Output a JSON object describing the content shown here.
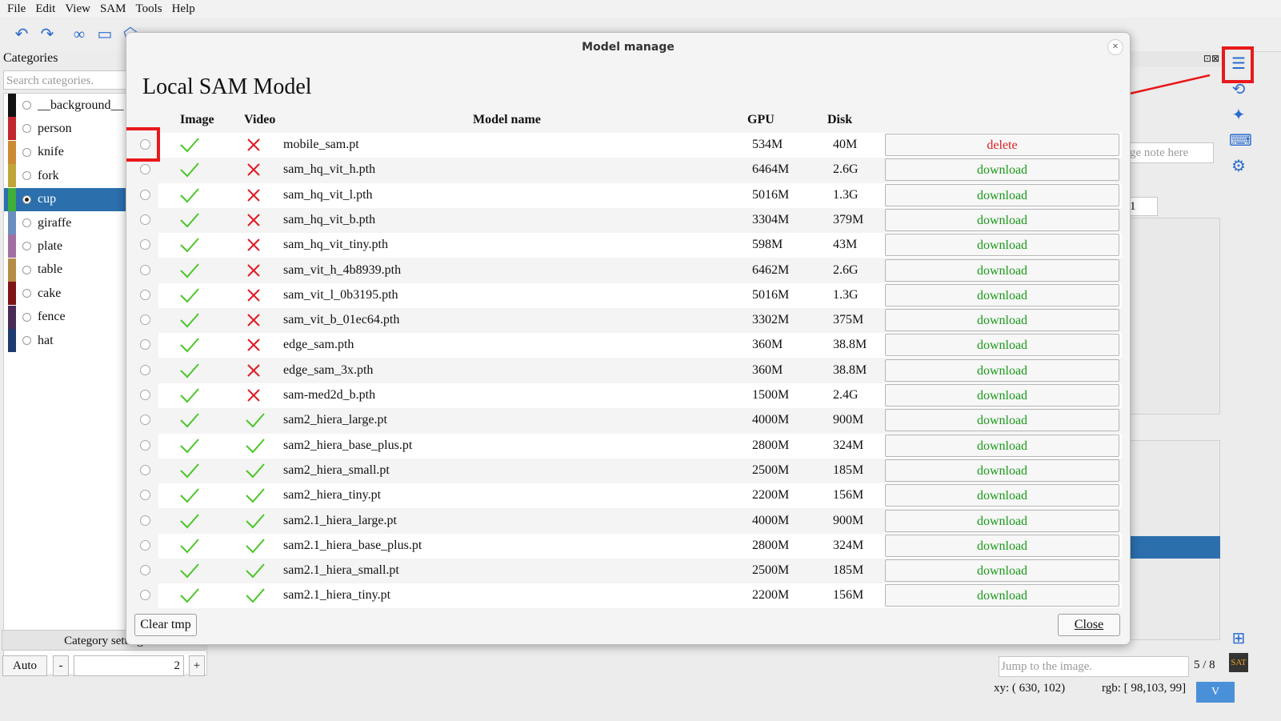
{
  "menu": [
    "File",
    "Edit",
    "View",
    "SAM",
    "Tools",
    "Help"
  ],
  "left_panel": {
    "title": "Categories",
    "search_placeholder": "Search categories.",
    "categories": [
      {
        "label": "__background__",
        "color": "#111111"
      },
      {
        "label": "person",
        "color": "#c0282d"
      },
      {
        "label": "knife",
        "color": "#cc8a32"
      },
      {
        "label": "fork",
        "color": "#c0a63a"
      },
      {
        "label": "cup",
        "color": "#3fae3a",
        "selected": true
      },
      {
        "label": "giraffe",
        "color": "#6a8fbf"
      },
      {
        "label": "plate",
        "color": "#a26fa3"
      },
      {
        "label": "table",
        "color": "#b58c45"
      },
      {
        "label": "cake",
        "color": "#7d1515"
      },
      {
        "label": "fence",
        "color": "#4a2b56"
      },
      {
        "label": "hat",
        "color": "#1f3a6e"
      }
    ],
    "category_setting_label": "Category setting",
    "auto_label": "Auto",
    "minus_label": "-",
    "plus_label": "+",
    "spin_value": "2"
  },
  "right_panel": {
    "note_placeholder": "ge note here",
    "spin_value": "1",
    "jump_placeholder": "Jump to the image.",
    "page_counter": "5 / 8"
  },
  "status": {
    "xy": "xy: ( 630, 102)",
    "rgb": "rgb: [ 98,103, 99]",
    "version_label": "V"
  },
  "dialog": {
    "title": "Model manage",
    "close_x": "×",
    "heading": "Local SAM Model",
    "columns": {
      "image": "Image",
      "video": "Video",
      "name": "Model name",
      "gpu": "GPU",
      "disk": "Disk"
    },
    "models": [
      {
        "name": "mobile_sam.pt",
        "video": false,
        "gpu": "534M",
        "disk": "40M",
        "action": "delete"
      },
      {
        "name": "sam_hq_vit_h.pth",
        "video": false,
        "gpu": "6464M",
        "disk": "2.6G",
        "action": "download"
      },
      {
        "name": "sam_hq_vit_l.pth",
        "video": false,
        "gpu": "5016M",
        "disk": "1.3G",
        "action": "download"
      },
      {
        "name": "sam_hq_vit_b.pth",
        "video": false,
        "gpu": "3304M",
        "disk": "379M",
        "action": "download"
      },
      {
        "name": "sam_hq_vit_tiny.pth",
        "video": false,
        "gpu": "598M",
        "disk": "43M",
        "action": "download"
      },
      {
        "name": "sam_vit_h_4b8939.pth",
        "video": false,
        "gpu": "6462M",
        "disk": "2.6G",
        "action": "download"
      },
      {
        "name": "sam_vit_l_0b3195.pth",
        "video": false,
        "gpu": "5016M",
        "disk": "1.3G",
        "action": "download"
      },
      {
        "name": "sam_vit_b_01ec64.pth",
        "video": false,
        "gpu": "3302M",
        "disk": "375M",
        "action": "download"
      },
      {
        "name": "edge_sam.pth",
        "video": false,
        "gpu": "360M",
        "disk": "38.8M",
        "action": "download"
      },
      {
        "name": "edge_sam_3x.pth",
        "video": false,
        "gpu": "360M",
        "disk": "38.8M",
        "action": "download"
      },
      {
        "name": "sam-med2d_b.pth",
        "video": false,
        "gpu": "1500M",
        "disk": "2.4G",
        "action": "download"
      },
      {
        "name": "sam2_hiera_large.pt",
        "video": true,
        "gpu": "4000M",
        "disk": "900M",
        "action": "download"
      },
      {
        "name": "sam2_hiera_base_plus.pt",
        "video": true,
        "gpu": "2800M",
        "disk": "324M",
        "action": "download"
      },
      {
        "name": "sam2_hiera_small.pt",
        "video": true,
        "gpu": "2500M",
        "disk": "185M",
        "action": "download"
      },
      {
        "name": "sam2_hiera_tiny.pt",
        "video": true,
        "gpu": "2200M",
        "disk": "156M",
        "action": "download"
      },
      {
        "name": "sam2.1_hiera_large.pt",
        "video": true,
        "gpu": "4000M",
        "disk": "900M",
        "action": "download"
      },
      {
        "name": "sam2.1_hiera_base_plus.pt",
        "video": true,
        "gpu": "2800M",
        "disk": "324M",
        "action": "download"
      },
      {
        "name": "sam2.1_hiera_small.pt",
        "video": true,
        "gpu": "2500M",
        "disk": "185M",
        "action": "download"
      },
      {
        "name": "sam2.1_hiera_tiny.pt",
        "video": true,
        "gpu": "2200M",
        "disk": "156M",
        "action": "download"
      }
    ],
    "clear_tmp_label": "Clear tmp",
    "close_label": "Close"
  },
  "colors": {
    "accent": "#2a6bd1",
    "selection": "#2b6fad",
    "download": "#1a9a1a",
    "delete": "#e02020",
    "check": "#4cc62a",
    "cross": "#e01b24",
    "highlight": "#e8191b"
  }
}
